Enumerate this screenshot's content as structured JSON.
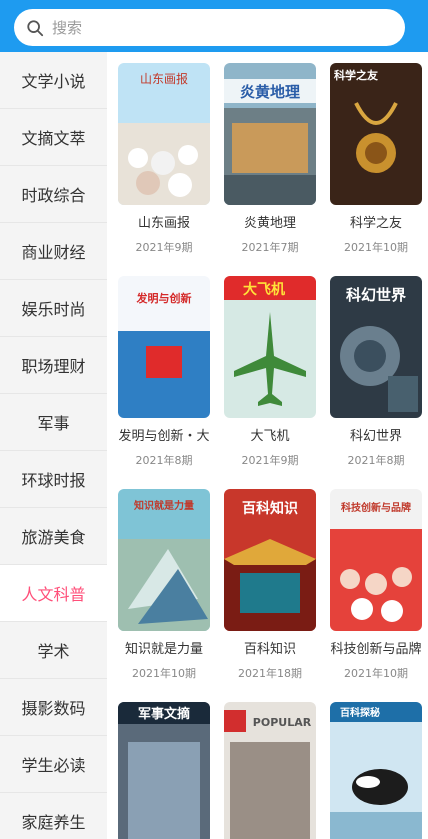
{
  "search": {
    "placeholder": "搜索",
    "icon": "search-icon"
  },
  "sidebar": {
    "items": [
      {
        "label": "文学小说",
        "active": false
      },
      {
        "label": "文摘文萃",
        "active": false
      },
      {
        "label": "时政综合",
        "active": false
      },
      {
        "label": "商业财经",
        "active": false
      },
      {
        "label": "娱乐时尚",
        "active": false
      },
      {
        "label": "职场理财",
        "active": false
      },
      {
        "label": "军事",
        "active": false
      },
      {
        "label": "环球时报",
        "active": false
      },
      {
        "label": "旅游美食",
        "active": false
      },
      {
        "label": "人文科普",
        "active": true
      },
      {
        "label": "学术",
        "active": false
      },
      {
        "label": "摄影数码",
        "active": false
      },
      {
        "label": "学生必读",
        "active": false
      },
      {
        "label": "家庭养生",
        "active": false
      }
    ],
    "active_color": "#ff4f79"
  },
  "magazines": [
    {
      "title": "山东画报",
      "issue": "2021年9期",
      "cover_text": "山东画报"
    },
    {
      "title": "炎黄地理",
      "issue": "2021年7期",
      "cover_text": "炎黄地理"
    },
    {
      "title": "科学之友",
      "issue": "2021年10期",
      "cover_text": "科学之友"
    },
    {
      "title": "发明与创新・大",
      "issue": "2021年8期",
      "cover_text": "发明与创新"
    },
    {
      "title": "大飞机",
      "issue": "2021年9期",
      "cover_text": "大飞机"
    },
    {
      "title": "科幻世界",
      "issue": "2021年8期",
      "cover_text": "科幻世界"
    },
    {
      "title": "知识就是力量",
      "issue": "2021年10期",
      "cover_text": "知识就是力量"
    },
    {
      "title": "百科知识",
      "issue": "2021年18期",
      "cover_text": "百科知识"
    },
    {
      "title": "科技创新与品牌",
      "issue": "2021年10期",
      "cover_text": "科技创新与品牌"
    },
    {
      "title": "",
      "issue": "",
      "cover_text": "军事文摘"
    },
    {
      "title": "",
      "issue": "",
      "cover_text": "POPULAR"
    },
    {
      "title": "",
      "issue": "",
      "cover_text": "百科探秘"
    }
  ],
  "colors": {
    "topbar": "#1e9bf0",
    "sidebar_bg": "#f4f4f4"
  }
}
